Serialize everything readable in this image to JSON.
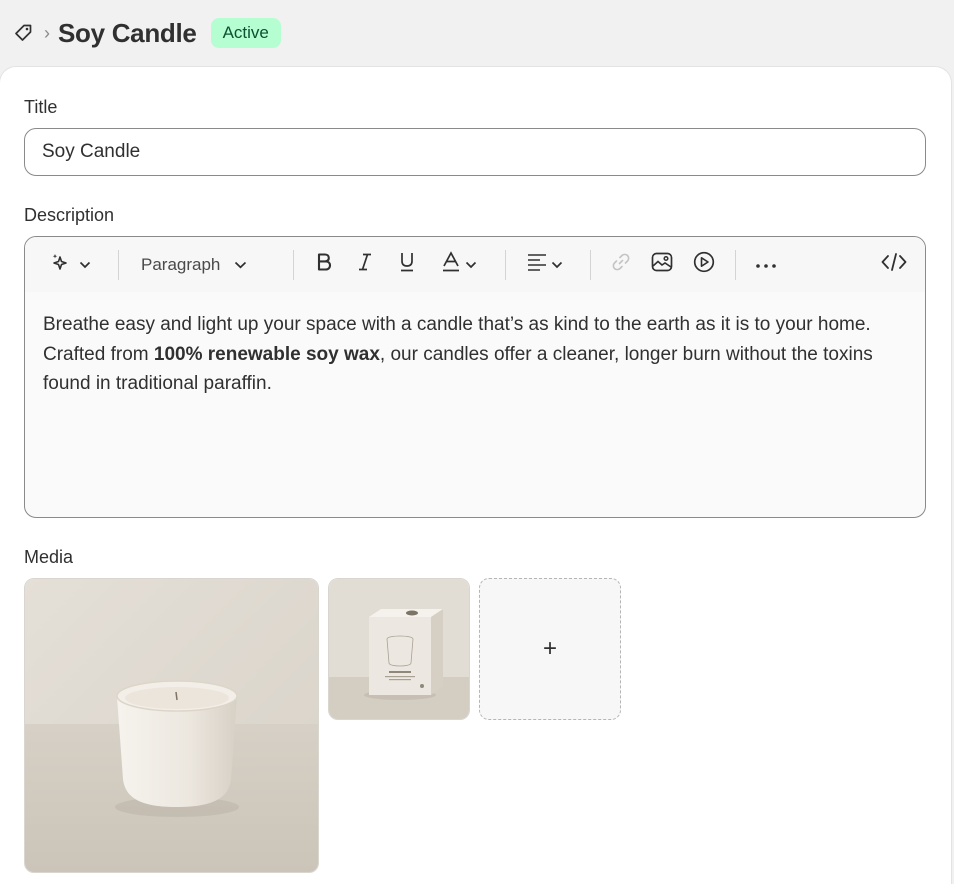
{
  "header": {
    "breadcrumb_icon": "tag-icon",
    "separator": "›",
    "title": "Soy Candle",
    "status": "Active",
    "status_bg": "#b4fed2",
    "status_fg": "#0c5132"
  },
  "title_field": {
    "label": "Title",
    "value": "Soy Candle"
  },
  "description": {
    "label": "Description",
    "toolbar": {
      "ai_icon": "magic-sparkle-icon",
      "format_select": "Paragraph",
      "bold_icon": "bold-icon",
      "italic_icon": "italic-icon",
      "underline_icon": "underline-icon",
      "text_color_icon": "text-color-icon",
      "align_icon": "align-left-icon",
      "link_icon": "link-icon",
      "image_icon": "image-icon",
      "video_icon": "video-icon",
      "more_icon": "more-icon",
      "code_icon": "code-icon"
    },
    "body": {
      "part1": "Breathe easy and light up your space with a candle that’s as kind to the earth as it is to your home. Crafted from ",
      "bold": "100% renewable soy wax",
      "part2": ", our candles offer a cleaner, longer burn without the toxins found in traditional paraffin."
    }
  },
  "media": {
    "label": "Media",
    "items": [
      {
        "name": "candle-photo",
        "description": "white ceramic soy candle"
      },
      {
        "name": "candle-box-photo",
        "description": "candle packaging box"
      }
    ],
    "add_label": "+"
  }
}
